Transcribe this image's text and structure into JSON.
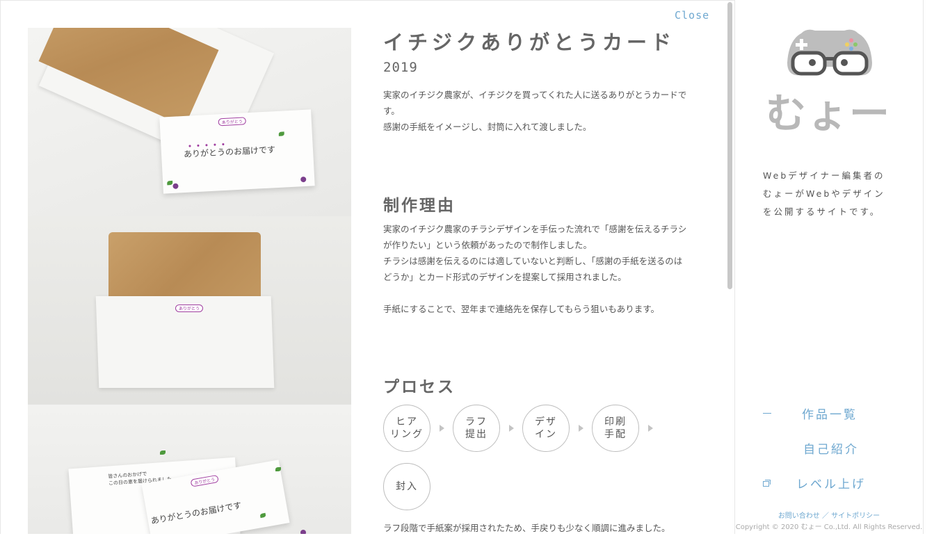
{
  "modal": {
    "close_label": "Close"
  },
  "work": {
    "title": "イチジクありがとうカード",
    "year": "2019",
    "intro": [
      "実家のイチジク農家が、イチジクを買ってくれた人に送るありがとうカードで",
      "す。",
      "感謝の手紙をイメージし、封筒に入れて渡しました。"
    ],
    "reason_heading": "制作理由",
    "reason": [
      "実家のイチジク農家のチラシデザインを手伝った流れで「感謝を伝えるチラシ",
      "が作りたい」という依頼があったので制作しました。",
      "チラシは感謝を伝えるのには適していないと判断し、「感謝の手紙を送るのは",
      "どうか」とカード形式のデザインを提案して採用されました。",
      "",
      "手紙にすることで、翌年まで連絡先を保存してもらう狙いもあります。"
    ],
    "process_heading": "プロセス",
    "process_steps": [
      "ヒア\nリング",
      "ラフ\n提出",
      "デザ\nイン",
      "印刷\n手配",
      "封入"
    ],
    "process_note": "ラフ段階で手紙案が採用されたため、手戻りも少なく順調に進みました。"
  },
  "photos": {
    "card_text": "ありがとうのお届けです",
    "tag_text": "ありがとう",
    "note_text_1": "皆さんのおかげで",
    "note_text_2": "この日の恵を届けられました"
  },
  "sidebar": {
    "logo_text": "むょー",
    "tagline": [
      "Webデザイナー編集者の",
      "むょーがWebやデザイン",
      "を公開するサイトです。"
    ],
    "nav": [
      {
        "label": "作品一覧",
        "icon": "dash-icon"
      },
      {
        "label": "自己紹介",
        "icon": ""
      },
      {
        "label": "レベル上げ",
        "icon": "window-icon"
      }
    ],
    "footer_links": "お問い合わせ ／ サイトポリシー",
    "copyright": "Copyright © 2020 むょー Co.,Ltd. All Rights Reserved."
  },
  "colors": {
    "accent": "#6fa8d0",
    "text": "#555555",
    "kraft": "#c49a63",
    "grape": "#7b3f8c"
  }
}
